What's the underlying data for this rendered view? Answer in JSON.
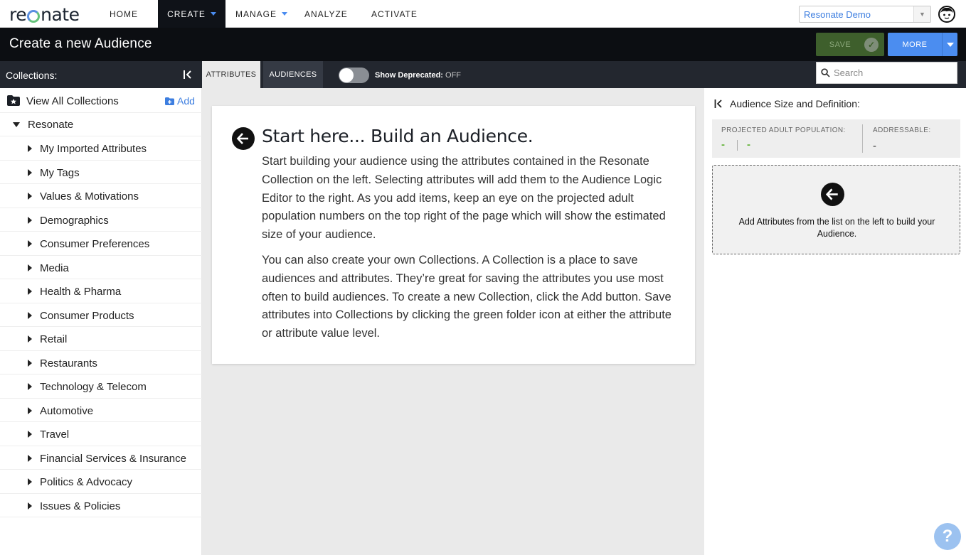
{
  "brand": {
    "logo_text_pre": "re",
    "logo_text_post": "nate"
  },
  "nav": {
    "items": [
      {
        "label": "HOME"
      },
      {
        "label": "CREATE"
      },
      {
        "label": "MANAGE"
      },
      {
        "label": "ANALYZE"
      },
      {
        "label": "ACTIVATE"
      }
    ],
    "account": "Resonate Demo"
  },
  "header": {
    "title": "Create a new Audience",
    "save_label": "SAVE",
    "more_label": "MORE"
  },
  "subbar": {
    "collections_label": "Collections:",
    "tabs": [
      {
        "label": "ATTRIBUTES"
      },
      {
        "label": "AUDIENCES"
      }
    ],
    "toggle_label": "Show Deprecated:",
    "toggle_state": "OFF",
    "search_placeholder": "Search"
  },
  "sidebar": {
    "view_all": "View All Collections",
    "add": "Add",
    "root": "Resonate",
    "items": [
      "My Imported Attributes",
      "My Tags",
      "Values & Motivations",
      "Demographics",
      "Consumer Preferences",
      "Media",
      "Health & Pharma",
      "Consumer Products",
      "Retail",
      "Restaurants",
      "Technology & Telecom",
      "Automotive",
      "Travel",
      "Financial Services & Insurance",
      "Politics & Advocacy",
      "Issues & Policies"
    ]
  },
  "main": {
    "heading": "Start here... Build an Audience.",
    "para1": "Start building your audience using the attributes contained in the Resonate Collection on the left. Selecting attributes will add them to the Audience Logic Editor to the right. As you add items, keep an eye on the projected adult population numbers on the top right of the page which will show the estimated size of your audience.",
    "para2": "You can also create your own Collections. A Collection is a place to save audiences and attributes. They’re great for saving the attributes you use most often to build audiences. To create a new Collection, click the Add button. Save attributes into Collections by clicking the green folder icon at either the attribute or attribute value level."
  },
  "right_panel": {
    "title": "Audience Size and Definition:",
    "projected_label": "PROJECTED ADULT POPULATION:",
    "projected_value_1": "-",
    "projected_value_2": "-",
    "addressable_label": "ADDRESSABLE:",
    "addressable_value": "-",
    "dropzone_message": "Add Attributes from the list on the left to build your Audience."
  },
  "help": {
    "label": "?"
  },
  "colors": {
    "accent_blue": "#4b8df0",
    "save_green": "#3e5f2c",
    "value_green": "#64b33a",
    "dark_bar": "#0c0e12"
  }
}
